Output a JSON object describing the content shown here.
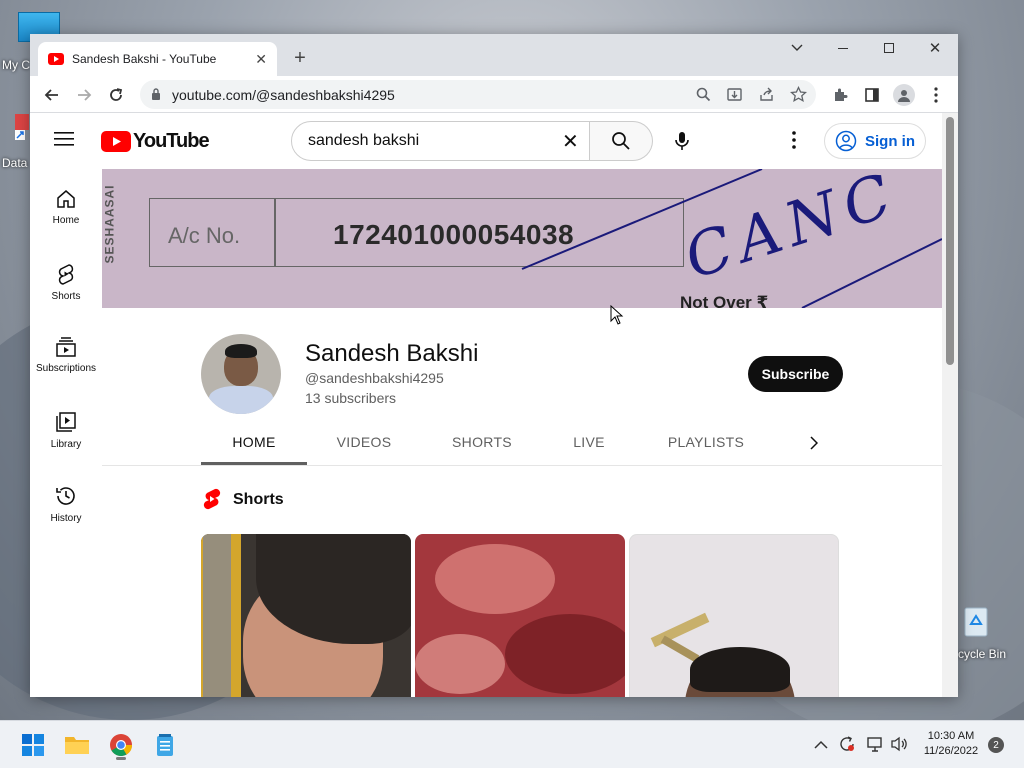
{
  "desktop": {
    "icons": [
      {
        "label": "My C"
      },
      {
        "label": "Data"
      },
      {
        "label": "cycle Bin"
      }
    ]
  },
  "browser": {
    "tab_title": "Sandesh Bakshi - YouTube",
    "url": "youtube.com/@sandeshbakshi4295"
  },
  "youtube": {
    "logo_text": "YouTube",
    "search": {
      "value": "sandesh bakshi"
    },
    "signin_label": "Sign in",
    "sidebar": [
      {
        "label": "Home"
      },
      {
        "label": "Shorts"
      },
      {
        "label": "Subscriptions"
      },
      {
        "label": "Library"
      },
      {
        "label": "History"
      }
    ],
    "banner": {
      "side_text": "SESHAASAI",
      "ac_label": "A/c No.",
      "ac_number": "172401000054038",
      "cancel_text": "CANC",
      "not_over_text": "Not Over ₹"
    },
    "channel": {
      "name": "Sandesh Bakshi",
      "handle": "@sandeshbakshi4295",
      "subscribers": "13 subscribers",
      "subscribe_label": "Subscribe"
    },
    "tabs": [
      {
        "label": "HOME",
        "active": true
      },
      {
        "label": "VIDEOS"
      },
      {
        "label": "SHORTS"
      },
      {
        "label": "LIVE"
      },
      {
        "label": "PLAYLISTS"
      }
    ],
    "shorts_section_title": "Shorts"
  },
  "taskbar": {
    "time": "10:30 AM",
    "date": "11/26/2022",
    "notification_count": "2"
  },
  "colors": {
    "youtube_red": "#ff0000",
    "link_blue": "#065fd4",
    "banner_pink": "#c9b6c8"
  }
}
